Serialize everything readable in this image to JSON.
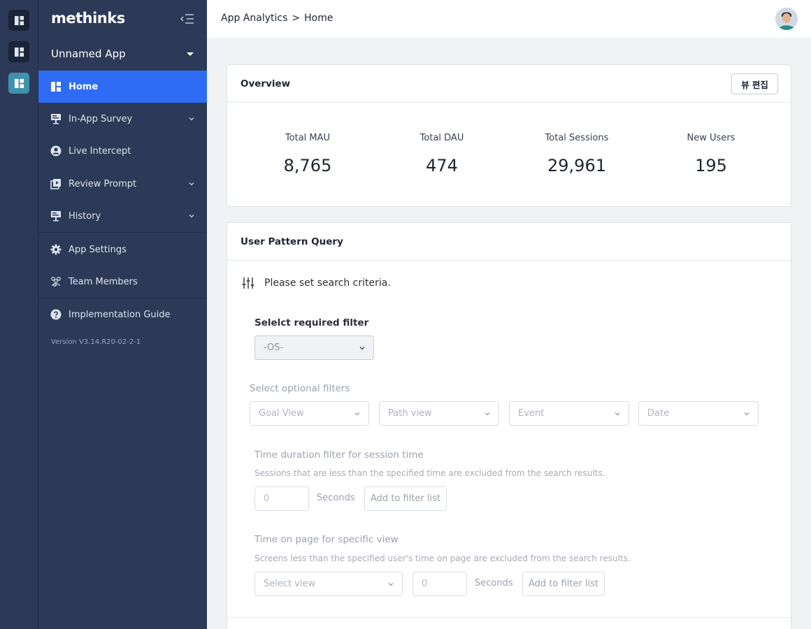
{
  "rail": {
    "buttons": [
      {
        "icon": "dashboard-icon"
      },
      {
        "icon": "dashboard-icon"
      },
      {
        "icon": "dashboard-icon"
      }
    ]
  },
  "sidebar": {
    "logo": "methinks",
    "app_name": "Unnamed App",
    "items": [
      {
        "label": "Home",
        "icon": "dashboard-icon"
      },
      {
        "label": "In-App Survey",
        "icon": "presentation-icon"
      },
      {
        "label": "Live Intercept",
        "icon": "user-circle-icon"
      },
      {
        "label": "Review Prompt",
        "icon": "video-stack-icon"
      },
      {
        "label": "History",
        "icon": "presentation-icon"
      },
      {
        "label": "App Settings",
        "icon": "gear-icon"
      },
      {
        "label": "Team Members",
        "icon": "team-icon"
      },
      {
        "label": "Implementation Guide",
        "icon": "help-icon"
      }
    ],
    "version": "Version V3.14.R20-02-2-1"
  },
  "topbar": {
    "breadcrumb": [
      "App Analytics",
      ">",
      "Home"
    ]
  },
  "overview": {
    "title": "Overview",
    "edit_label": "뷰 편집",
    "stats": [
      {
        "label": "Total MAU",
        "value": "8,765"
      },
      {
        "label": "Total DAU",
        "value": "474"
      },
      {
        "label": "Total Sessions",
        "value": "29,961"
      },
      {
        "label": "New Users",
        "value": "195"
      }
    ]
  },
  "query": {
    "title": "User Pattern Query",
    "criteria": "Please set search criteria.",
    "required_title": "Selelct required filter",
    "required_select": "-OS-",
    "optional_title": "Select optional filters",
    "optional_selects": [
      "Goal View",
      "Path view",
      "Event",
      "Date"
    ],
    "duration_title": "Time duration filter for session time",
    "duration_desc": "Sessions that are less than the specified time are excluded from the search results.",
    "duration_value": "0",
    "duration_unit": "Seconds",
    "duration_add": "Add to filter list",
    "page_title": "Time on page for specific view",
    "page_desc": "Screens less than the specified user's time on page are excluded from the search results.",
    "page_select": "Select view",
    "page_value": "0",
    "page_unit": "Seconds",
    "page_add": "Add to filter list"
  },
  "colors": {
    "sidebar_bg": "#2c3a57",
    "active_item": "#2e6cf6",
    "rail_active": "#3f91ad"
  }
}
